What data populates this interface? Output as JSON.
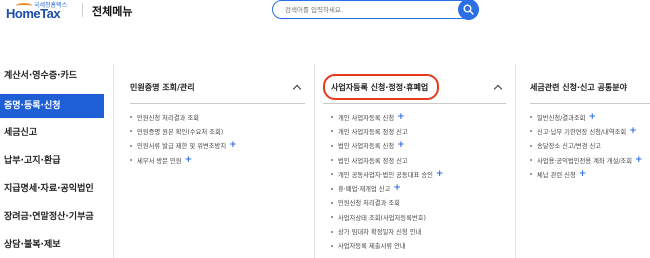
{
  "header": {
    "logo_small": "국세청홈택스",
    "logo_main": "HomeTax",
    "menu_title": "전체메뉴",
    "search_placeholder": "검색어를 입력하세요."
  },
  "sidebar": {
    "items": [
      {
        "label": "계산서·영수증·카드"
      },
      {
        "label": "증명·등록·신청",
        "active": true
      },
      {
        "label": "세금신고"
      },
      {
        "label": "납부·고지·환급"
      },
      {
        "label": "지급명세·자료·공익법인"
      },
      {
        "label": "장려금·연말정산·기부금"
      },
      {
        "label": "상담·불복·제보"
      }
    ]
  },
  "panels": [
    {
      "title": "민원증명 조회/관리",
      "items": [
        {
          "label": "민원신청 처리결과 조회",
          "plus": false
        },
        {
          "label": "민원증명 원본 확인(수요처 조회)",
          "plus": false
        },
        {
          "label": "민원서류 발급 제한 및 위변조방지",
          "plus": true
        },
        {
          "label": "세무서 방문 민원",
          "plus": true
        }
      ]
    },
    {
      "title": "사업자등록 신청·정정·휴폐업",
      "items": [
        {
          "label": "개인 사업자등록 신청",
          "plus": true
        },
        {
          "label": "개인 사업자등록 정정 신고",
          "plus": false
        },
        {
          "label": "법인 사업자등록 신청",
          "plus": true
        },
        {
          "label": "법인 사업자등록 정정 신고",
          "plus": false
        },
        {
          "label": "개인 공동사업자·법인 공동대표 승인",
          "plus": true
        },
        {
          "label": "휴·폐업·재개업 신고",
          "plus": true
        },
        {
          "label": "민원신청 처리결과 조회",
          "plus": false
        },
        {
          "label": "사업자상태 조회(사업자등록번호)",
          "plus": false
        },
        {
          "label": "상가 임대차 확정일자 신청 안내",
          "plus": false
        },
        {
          "label": "사업자등록 제출서류 안내",
          "plus": false
        }
      ]
    },
    {
      "title": "세금관련 신청·신고 공통분야",
      "items": [
        {
          "label": "일반신청/결과조회",
          "plus": true
        },
        {
          "label": "신고·납부 기한연장 신청/내역조회",
          "plus": true
        },
        {
          "label": "송달장소 신고/변경 신고",
          "plus": false
        },
        {
          "label": "사업용·공익법인전용 계좌 개설/조회",
          "plus": true
        },
        {
          "label": "체납 관련 신청",
          "plus": true
        }
      ]
    }
  ],
  "colors": {
    "accent": "#1f5fd6",
    "highlight": "#e8391c",
    "plus": "#2b6ee6"
  },
  "icons": [
    "search-icon",
    "chevron-up-icon",
    "plus-icon"
  ]
}
